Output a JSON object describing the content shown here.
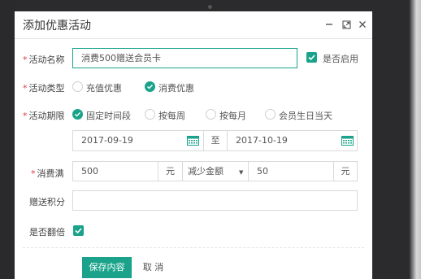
{
  "dialog": {
    "title": "添加优惠活动",
    "controls": {
      "minimize": "—",
      "maximize": "⤢",
      "close": "×"
    }
  },
  "form": {
    "name": {
      "label": "活动名称",
      "value": "消费500赠送会员卡",
      "enable_label": "是否启用",
      "enabled": true
    },
    "type": {
      "label": "活动类型",
      "options": [
        "充值优惠",
        "消费优惠"
      ],
      "selected": "消费优惠"
    },
    "period": {
      "label": "活动期限",
      "options": [
        "固定时间段",
        "按每周",
        "按每月",
        "会员生日当天"
      ],
      "selected": "固定时间段",
      "start_date": "2017-09-19",
      "to_label": "至",
      "end_date": "2017-10-19"
    },
    "spend": {
      "label": "消费满",
      "amount": "500",
      "unit": "元",
      "mode": "减少金额",
      "discount": "50",
      "discount_unit": "元"
    },
    "points": {
      "label": "赠送积分",
      "value": ""
    },
    "double": {
      "label": "是否翻倍",
      "checked": true
    }
  },
  "buttons": {
    "save": "保存内容",
    "cancel": "取 消"
  },
  "colors": {
    "accent": "#1aa38a",
    "required": "#e4393c"
  }
}
